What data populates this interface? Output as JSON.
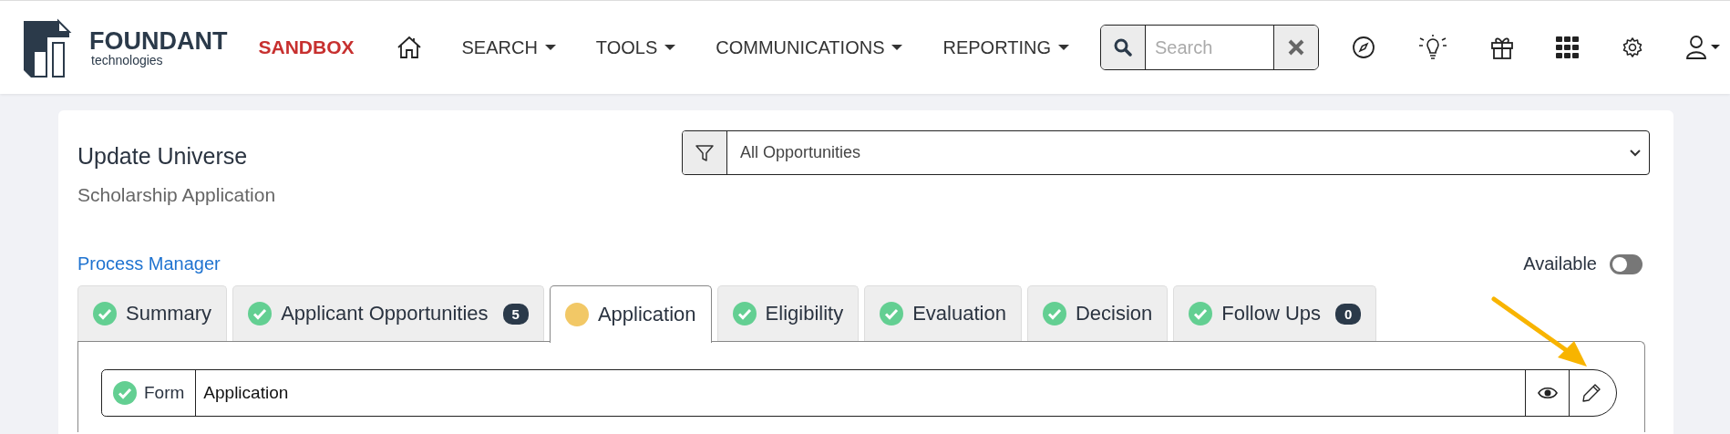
{
  "header": {
    "logo_name": "FOUNDANT",
    "logo_sub": "technologies",
    "environment": "SANDBOX",
    "nav": [
      {
        "label": "SEARCH",
        "dropdown": true
      },
      {
        "label": "TOOLS",
        "dropdown": true
      },
      {
        "label": "COMMUNICATIONS",
        "dropdown": true
      },
      {
        "label": "REPORTING",
        "dropdown": true
      }
    ],
    "search": {
      "placeholder": "Search"
    }
  },
  "page": {
    "title": "Update Universe",
    "subtitle": "Scholarship Application",
    "filter": {
      "value": "All Opportunities"
    },
    "link": "Process Manager",
    "available": {
      "label": "Available",
      "on": false
    }
  },
  "tabs": [
    {
      "label": "Summary",
      "kind": "complete",
      "selected": false
    },
    {
      "label": "Applicant Opportunities",
      "kind": "complete",
      "badge": "5",
      "selected": false
    },
    {
      "label": "Application",
      "kind": "pending",
      "selected": true
    },
    {
      "label": "Eligibility",
      "kind": "complete",
      "selected": false
    },
    {
      "label": "Evaluation",
      "kind": "complete",
      "selected": false
    },
    {
      "label": "Decision",
      "kind": "complete",
      "selected": false
    },
    {
      "label": "Follow Ups",
      "kind": "complete",
      "badge": "0",
      "selected": false
    }
  ],
  "form_row": {
    "label": "Form",
    "kind": "complete",
    "value": "Application"
  }
}
